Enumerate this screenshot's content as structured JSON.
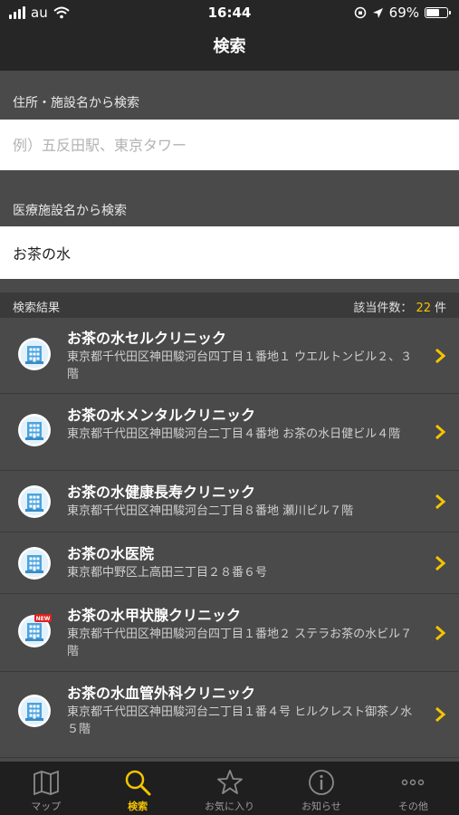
{
  "status_bar": {
    "carrier": "au",
    "time": "16:44",
    "battery": "69%",
    "battery_level": 0.69
  },
  "nav": {
    "title": "検索"
  },
  "address_search": {
    "label": "住所・施設名から検索",
    "value": "",
    "placeholder": "例）五反田駅、東京タワー"
  },
  "facility_search": {
    "label": "医療施設名から検索",
    "value": "お茶の水"
  },
  "results": {
    "label": "検索結果",
    "count_prefix": "該当件数：",
    "count": "22",
    "count_suffix": "件",
    "items": [
      {
        "name": "お茶の水セルクリニック",
        "address": "東京都千代田区神田駿河台四丁目１番地１ ウエルトンビル２、３階",
        "icon": "hospital-building-icon",
        "new": false
      },
      {
        "name": "お茶の水メンタルクリニック",
        "address": "東京都千代田区神田駿河台二丁目４番地 お茶の水日健ビル４階",
        "icon": "hospital-building-icon",
        "new": false
      },
      {
        "name": "お茶の水健康長寿クリニック",
        "address": "東京都千代田区神田駿河台二丁目８番地 瀬川ビル７階",
        "icon": "hospital-building-icon",
        "new": false
      },
      {
        "name": "お茶の水医院",
        "address": "東京都中野区上高田三丁目２８番６号",
        "icon": "hospital-building-icon",
        "new": false
      },
      {
        "name": "お茶の水甲状腺クリニック",
        "address": "東京都千代田区神田駿河台四丁目１番地２ ステラお茶の水ビル７階",
        "icon": "hospital-building-icon",
        "new": true,
        "new_badge": "NEW"
      },
      {
        "name": "お茶の水血管外科クリニック",
        "address": "東京都千代田区神田駿河台二丁目１番４号 ヒルクレスト御茶ノ水５階",
        "icon": "hospital-building-icon",
        "new": false
      }
    ]
  },
  "tabbar": {
    "tabs": [
      {
        "label": "マップ",
        "icon": "map-icon",
        "active": false
      },
      {
        "label": "検索",
        "icon": "search-icon",
        "active": true
      },
      {
        "label": "お気に入り",
        "icon": "star-icon",
        "active": false
      },
      {
        "label": "お知らせ",
        "icon": "info-icon",
        "active": false
      },
      {
        "label": "その他",
        "icon": "more-icon",
        "active": false
      }
    ]
  },
  "colors": {
    "accent": "#f5c400",
    "bar": "#262626",
    "list_bg": "#4a4a4a",
    "icon_blue": "#4aa3df"
  }
}
